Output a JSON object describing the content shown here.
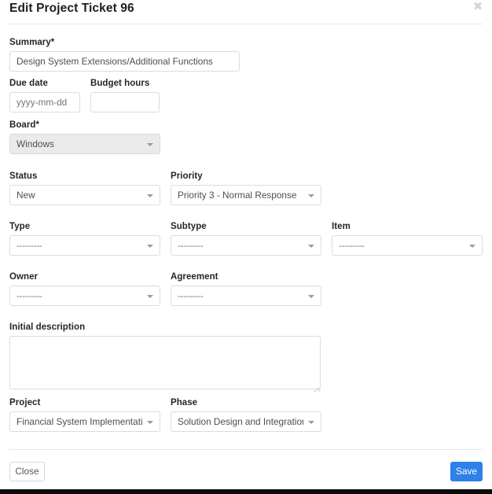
{
  "modal": {
    "title": "Edit Project Ticket 96",
    "close_icon_glyph": "✖",
    "close_icon_name": "close-icon"
  },
  "form": {
    "summary": {
      "label": "Summary*",
      "value": "Design System Extensions/Additional Functions",
      "placeholder": ""
    },
    "due_date": {
      "label": "Due date",
      "value": "",
      "placeholder": "yyyy-mm-dd"
    },
    "budget_hours": {
      "label": "Budget hours",
      "value": "",
      "placeholder": ""
    },
    "board": {
      "label": "Board*",
      "value": "Windows",
      "disabled": true
    },
    "status": {
      "label": "Status",
      "value": "New"
    },
    "priority": {
      "label": "Priority",
      "value": "Priority 3 - Normal Response"
    },
    "type": {
      "label": "Type",
      "value": "---------"
    },
    "subtype": {
      "label": "Subtype",
      "value": "---------"
    },
    "item": {
      "label": "Item",
      "value": "---------"
    },
    "owner": {
      "label": "Owner",
      "value": "---------"
    },
    "agreement": {
      "label": "Agreement",
      "value": "---------"
    },
    "initial_description": {
      "label": "Initial description",
      "value": "",
      "placeholder": ""
    },
    "project": {
      "label": "Project",
      "value": "Financial System Implementation"
    },
    "phase": {
      "label": "Phase",
      "value": "Solution Design and Integration"
    }
  },
  "footer": {
    "close_label": "Close",
    "save_label": "Save"
  },
  "colors": {
    "primary": "#2f80e8",
    "border": "#dcdcdc",
    "disabled_bg": "#e9eaeb",
    "text": "#4a4f54",
    "label_text": "#22262a"
  }
}
